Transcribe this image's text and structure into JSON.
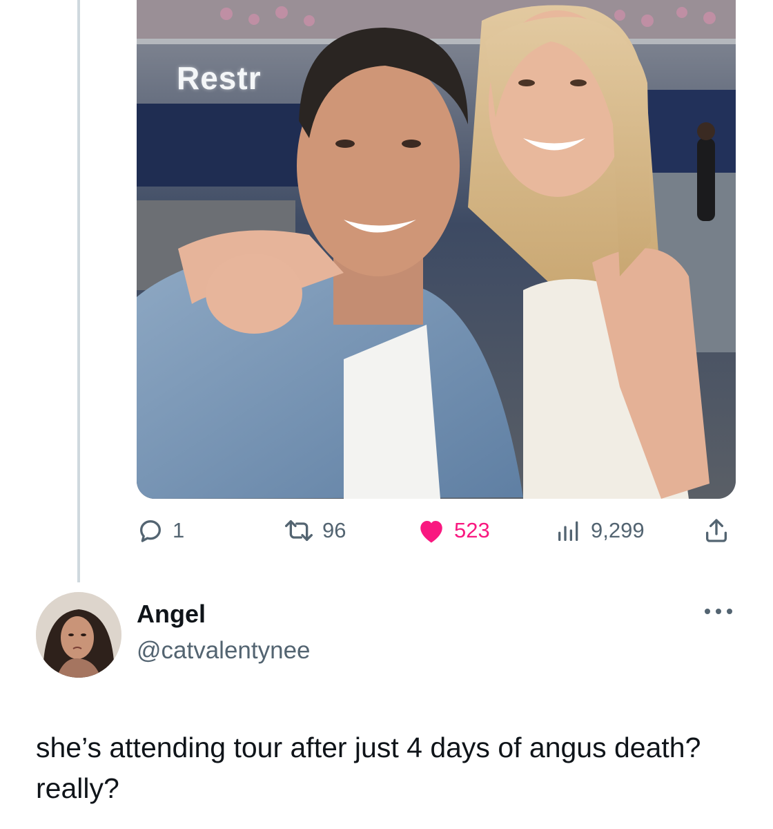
{
  "tweet_media": {
    "sign_text": "Restr"
  },
  "actions": {
    "reply_count": "1",
    "retweet_count": "96",
    "like_count": "523",
    "view_count": "9,299"
  },
  "reply": {
    "display_name": "Angel",
    "handle": "@catvalentynee",
    "text": "she’s attending tour after just 4 days of angus death? really?"
  },
  "colors": {
    "icon_gray": "#536471",
    "like_pink": "#f91880",
    "thread_line": "#cfd9de",
    "text_primary": "#0f1419"
  },
  "icons": [
    "reply-icon",
    "retweet-icon",
    "heart-icon",
    "views-icon",
    "share-icon",
    "more-icon"
  ]
}
